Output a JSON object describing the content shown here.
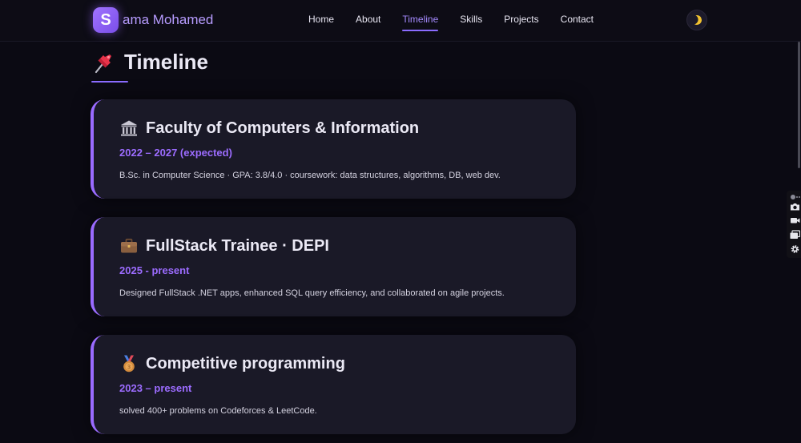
{
  "brand": {
    "initial": "S",
    "name": "ama Mohamed"
  },
  "nav": {
    "links": [
      "Home",
      "About",
      "Timeline",
      "Skills",
      "Projects",
      "Contact"
    ],
    "active": "Timeline"
  },
  "theme_toggle": {
    "icon": "moon-icon"
  },
  "section": {
    "title": "Timeline",
    "icon": "pushpin-icon"
  },
  "timeline": [
    {
      "icon": "classical-building-icon",
      "title": "Faculty of Computers & Information",
      "date": "2022 – 2027 (expected)",
      "description": "B.Sc. in Computer Science · GPA: 3.8/4.0 · coursework: data structures, algorithms, DB, web dev."
    },
    {
      "icon": "briefcase-icon",
      "title": "FullStack Trainee · DEPI",
      "date": "2025 - present",
      "description": "Designed FullStack .NET apps, enhanced SQL query efficiency, and collaborated on agile projects."
    },
    {
      "icon": "medal-icon",
      "title": "Competitive programming",
      "date": "2023 – present",
      "description": "solved 400+ problems on Codeforces & LeetCode."
    }
  ],
  "extension_toolbar": {
    "icons": [
      "extension-logo-icon",
      "camera-icon",
      "video-camera-icon",
      "window-icon",
      "gear-icon"
    ]
  },
  "colors": {
    "background": "#0b0a13",
    "card_background": "#1a1927",
    "accent": "#9a6bff",
    "nav_active": "#a58bff",
    "brand_text": "#b79cff"
  }
}
